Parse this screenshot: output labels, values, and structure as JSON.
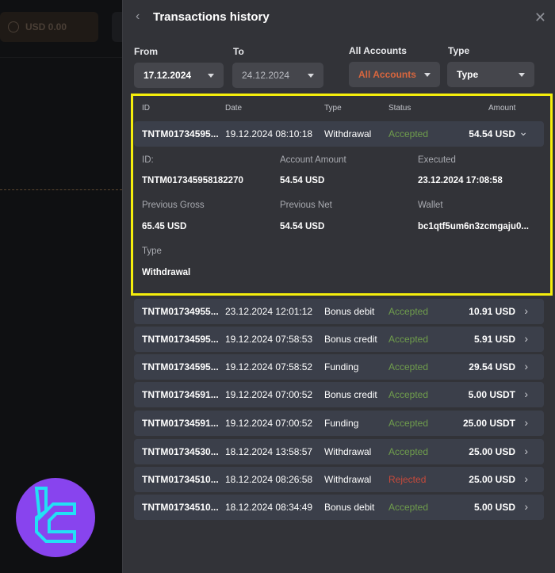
{
  "background": {
    "balance_label": "USD 0.00"
  },
  "panel": {
    "title": "Transactions history",
    "back_icon": "chevron-left-icon",
    "close_icon": "close-icon"
  },
  "filters": {
    "from": {
      "label": "From",
      "value": "17.12.2024"
    },
    "to": {
      "label": "To",
      "value": "24.12.2024"
    },
    "accounts": {
      "label": "All Accounts",
      "value": "All Accounts"
    },
    "type": {
      "label": "Type",
      "value": "Type"
    }
  },
  "table": {
    "columns": [
      "ID",
      "Date",
      "Type",
      "Status",
      "Amount"
    ],
    "expanded_row": {
      "id": "TNTM01734595...",
      "date": "19.12.2024 08:10:18",
      "type": "Withdrawal",
      "status": "Accepted",
      "amount": "54.54 USD",
      "details": {
        "id_label": "ID:",
        "id_value": "TNTM017345958182270",
        "account_amount_label": "Account Amount",
        "account_amount_value": "54.54 USD",
        "executed_label": "Executed",
        "executed_value": "23.12.2024 17:08:58",
        "previous_gross_label": "Previous Gross",
        "previous_gross_value": "65.45 USD",
        "previous_net_label": "Previous Net",
        "previous_net_value": "54.54 USD",
        "wallet_label": "Wallet",
        "wallet_value": "bc1qtf5um6n3zcmgaju0...",
        "type_label": "Type",
        "type_value": "Withdrawal"
      }
    },
    "rows": [
      {
        "id": "TNTM01734955...",
        "date": "23.12.2024 12:01:12",
        "type": "Bonus debit",
        "status": "Accepted",
        "amount": "10.91 USD"
      },
      {
        "id": "TNTM01734595...",
        "date": "19.12.2024 07:58:53",
        "type": "Bonus credit",
        "status": "Accepted",
        "amount": "5.91 USD"
      },
      {
        "id": "TNTM01734595...",
        "date": "19.12.2024 07:58:52",
        "type": "Funding",
        "status": "Accepted",
        "amount": "29.54 USD"
      },
      {
        "id": "TNTM01734591...",
        "date": "19.12.2024 07:00:52",
        "type": "Bonus credit",
        "status": "Accepted",
        "amount": "5.00 USDT"
      },
      {
        "id": "TNTM01734591...",
        "date": "19.12.2024 07:00:52",
        "type": "Funding",
        "status": "Accepted",
        "amount": "25.00 USDT"
      },
      {
        "id": "TNTM01734530...",
        "date": "18.12.2024 13:58:57",
        "type": "Withdrawal",
        "status": "Accepted",
        "amount": "25.00 USD"
      },
      {
        "id": "TNTM01734510...",
        "date": "18.12.2024 08:26:58",
        "type": "Withdrawal",
        "status": "Rejected",
        "amount": "25.00 USD"
      },
      {
        "id": "TNTM01734510...",
        "date": "18.12.2024 08:34:49",
        "type": "Bonus debit",
        "status": "Accepted",
        "amount": "5.00 USD"
      }
    ]
  },
  "colors": {
    "accepted": "#6f9d4c",
    "rejected": "#c84a3b",
    "accounts_accent": "#d8663e",
    "highlight": "#f5ee0c",
    "logo_bg": "#8844ee",
    "logo_fg": "#22e0f5"
  }
}
